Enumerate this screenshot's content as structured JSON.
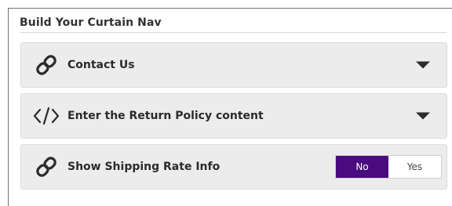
{
  "panel": {
    "title": "Build Your Curtain Nav"
  },
  "rows": [
    {
      "label": "Contact Us",
      "icon": "link-icon",
      "control": "expand-caret"
    },
    {
      "label": "Enter the Return Policy content",
      "icon": "code-icon",
      "control": "expand-caret"
    },
    {
      "label": "Show Shipping Rate Info",
      "icon": "link-icon",
      "control": "toggle",
      "toggle": {
        "options": [
          "No",
          "Yes"
        ],
        "selected": "No"
      }
    }
  ],
  "colors": {
    "accent": "#4b0b80",
    "row_background": "#ececec",
    "text": "#2b2b2b"
  }
}
